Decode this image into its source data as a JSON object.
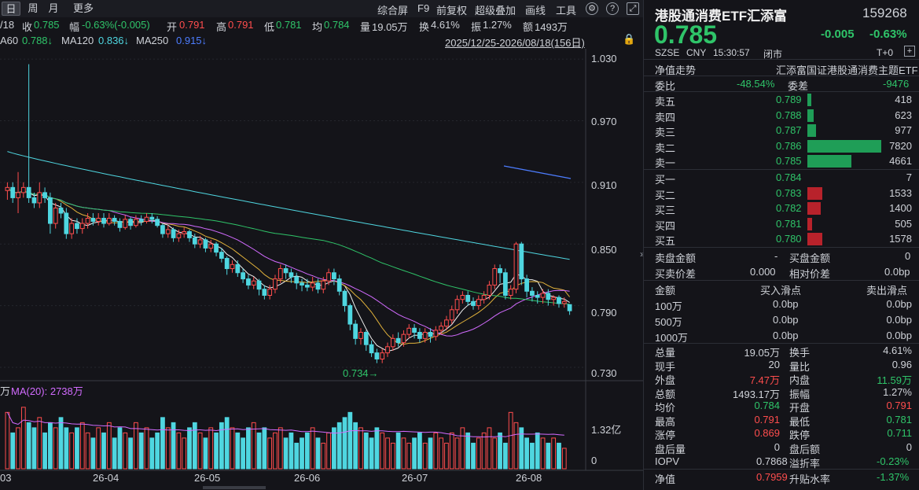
{
  "toolbar": {
    "periods": [
      "日",
      "周",
      "月",
      "更多"
    ],
    "tools": [
      "综合屏",
      "F9",
      "前复权",
      "超级叠加",
      "画线",
      "工具"
    ],
    "icon_names": [
      "gear-icon",
      "help-icon",
      "expand-icon"
    ]
  },
  "infobar": {
    "date": "/18",
    "close_label": "收",
    "close": "0.785",
    "chg_label": "幅",
    "chg": "-0.63%(-0.005)",
    "open_label": "开",
    "open": "0.791",
    "high_label": "高",
    "high": "0.791",
    "low_label": "低",
    "low": "0.781",
    "avg_label": "均",
    "avg": "0.784",
    "vol_label": "量",
    "vol": "19.05万",
    "turn_label": "换",
    "turn": "4.61%",
    "amp_label": "振",
    "amp": "1.27%",
    "amt_label": "额",
    "amt": "1493万"
  },
  "ma_bar": {
    "ma60": "A60",
    "ma60v": "0.788↓",
    "ma120": "MA120",
    "ma120v": "0.836↓",
    "ma250": "MA250",
    "ma250v": "0.915↓",
    "range": "2025/12/25-2026/08/18(156日)"
  },
  "price_axis": [
    "1.030",
    "0.970",
    "0.910",
    "0.850",
    "0.790",
    "0.730"
  ],
  "low_annot": "0.734→",
  "vol_bar": {
    "unit": "万",
    "ma20": "MA(20): 2738万"
  },
  "vol_axis": [
    "1.32亿",
    "0"
  ],
  "x_axis": [
    "03",
    "26-04",
    "26-05",
    "26-06",
    "26-07",
    "26-08"
  ],
  "chart_data": {
    "type": "candlestick",
    "ylim": [
      0.72,
      1.04
    ],
    "candles": [
      [
        0.902,
        0.905,
        0.893,
        0.91
      ],
      [
        0.905,
        0.895,
        0.89,
        0.91
      ],
      [
        0.895,
        0.9,
        0.88,
        0.92
      ],
      [
        0.9,
        0.905,
        0.895,
        0.91
      ],
      [
        0.905,
        0.895,
        0.89,
        1.025
      ],
      [
        0.895,
        0.89,
        0.885,
        0.9
      ],
      [
        0.89,
        0.9,
        0.885,
        0.91
      ],
      [
        0.9,
        0.895,
        0.89,
        0.905
      ],
      [
        0.895,
        0.87,
        0.86,
        0.9
      ],
      [
        0.87,
        0.885,
        0.865,
        0.89
      ],
      [
        0.885,
        0.88,
        0.875,
        0.89
      ],
      [
        0.88,
        0.86,
        0.855,
        0.885
      ],
      [
        0.86,
        0.87,
        0.855,
        0.875
      ],
      [
        0.87,
        0.865,
        0.86,
        0.875
      ],
      [
        0.865,
        0.87,
        0.86,
        0.875
      ],
      [
        0.87,
        0.875,
        0.865,
        0.88
      ],
      [
        0.875,
        0.872,
        0.868,
        0.88
      ],
      [
        0.872,
        0.875,
        0.868,
        0.88
      ],
      [
        0.875,
        0.87,
        0.866,
        0.88
      ],
      [
        0.87,
        0.875,
        0.868,
        0.88
      ],
      [
        0.875,
        0.872,
        0.868,
        0.878
      ],
      [
        0.872,
        0.866,
        0.862,
        0.875
      ],
      [
        0.866,
        0.874,
        0.864,
        0.878
      ],
      [
        0.874,
        0.868,
        0.864,
        0.876
      ],
      [
        0.868,
        0.874,
        0.866,
        0.878
      ],
      [
        0.874,
        0.872,
        0.868,
        0.878
      ],
      [
        0.872,
        0.876,
        0.87,
        0.88
      ],
      [
        0.876,
        0.874,
        0.87,
        0.88
      ],
      [
        0.874,
        0.868,
        0.866,
        0.877
      ],
      [
        0.868,
        0.86,
        0.856,
        0.87
      ],
      [
        0.86,
        0.864,
        0.856,
        0.868
      ],
      [
        0.864,
        0.856,
        0.852,
        0.866
      ],
      [
        0.856,
        0.86,
        0.852,
        0.864
      ],
      [
        0.86,
        0.862,
        0.856,
        0.866
      ],
      [
        0.862,
        0.856,
        0.852,
        0.864
      ],
      [
        0.856,
        0.85,
        0.846,
        0.86
      ],
      [
        0.85,
        0.854,
        0.846,
        0.858
      ],
      [
        0.854,
        0.846,
        0.842,
        0.856
      ],
      [
        0.846,
        0.85,
        0.842,
        0.854
      ],
      [
        0.85,
        0.842,
        0.838,
        0.852
      ],
      [
        0.842,
        0.836,
        0.832,
        0.846
      ],
      [
        0.836,
        0.826,
        0.82,
        0.838
      ],
      [
        0.826,
        0.83,
        0.822,
        0.834
      ],
      [
        0.83,
        0.822,
        0.818,
        0.834
      ],
      [
        0.822,
        0.816,
        0.812,
        0.826
      ],
      [
        0.816,
        0.81,
        0.806,
        0.82
      ],
      [
        0.81,
        0.814,
        0.806,
        0.818
      ],
      [
        0.814,
        0.806,
        0.8,
        0.816
      ],
      [
        0.806,
        0.8,
        0.796,
        0.81
      ],
      [
        0.8,
        0.806,
        0.796,
        0.81
      ],
      [
        0.806,
        0.816,
        0.802,
        0.82
      ],
      [
        0.816,
        0.826,
        0.812,
        0.83
      ],
      [
        0.826,
        0.822,
        0.816,
        0.83
      ],
      [
        0.822,
        0.818,
        0.812,
        0.826
      ],
      [
        0.818,
        0.812,
        0.806,
        0.822
      ],
      [
        0.812,
        0.81,
        0.804,
        0.816
      ],
      [
        0.81,
        0.808,
        0.804,
        0.816
      ],
      [
        0.808,
        0.812,
        0.804,
        0.818
      ],
      [
        0.812,
        0.806,
        0.802,
        0.816
      ],
      [
        0.806,
        0.814,
        0.802,
        0.818
      ],
      [
        0.814,
        0.822,
        0.81,
        0.826
      ],
      [
        0.822,
        0.816,
        0.81,
        0.826
      ],
      [
        0.816,
        0.804,
        0.8,
        0.82
      ],
      [
        0.804,
        0.79,
        0.784,
        0.806
      ],
      [
        0.79,
        0.772,
        0.766,
        0.792
      ],
      [
        0.772,
        0.758,
        0.752,
        0.776
      ],
      [
        0.758,
        0.764,
        0.752,
        0.768
      ],
      [
        0.764,
        0.752,
        0.746,
        0.766
      ],
      [
        0.752,
        0.744,
        0.74,
        0.756
      ],
      [
        0.744,
        0.738,
        0.734,
        0.748
      ],
      [
        0.738,
        0.744,
        0.734,
        0.748
      ],
      [
        0.744,
        0.75,
        0.74,
        0.754
      ],
      [
        0.75,
        0.758,
        0.746,
        0.762
      ],
      [
        0.758,
        0.754,
        0.75,
        0.764
      ],
      [
        0.754,
        0.762,
        0.75,
        0.766
      ],
      [
        0.762,
        0.768,
        0.758,
        0.772
      ],
      [
        0.768,
        0.764,
        0.758,
        0.772
      ],
      [
        0.764,
        0.758,
        0.754,
        0.768
      ],
      [
        0.758,
        0.764,
        0.754,
        0.768
      ],
      [
        0.764,
        0.76,
        0.754,
        0.768
      ],
      [
        0.76,
        0.766,
        0.756,
        0.77
      ],
      [
        0.766,
        0.77,
        0.762,
        0.774
      ],
      [
        0.77,
        0.776,
        0.766,
        0.78
      ],
      [
        0.776,
        0.786,
        0.772,
        0.79
      ],
      [
        0.786,
        0.796,
        0.782,
        0.8
      ],
      [
        0.796,
        0.8,
        0.792,
        0.804
      ],
      [
        0.8,
        0.794,
        0.79,
        0.804
      ],
      [
        0.794,
        0.79,
        0.786,
        0.798
      ],
      [
        0.79,
        0.796,
        0.786,
        0.8
      ],
      [
        0.796,
        0.8,
        0.792,
        0.804
      ],
      [
        0.8,
        0.81,
        0.796,
        0.814
      ],
      [
        0.81,
        0.826,
        0.806,
        0.83
      ],
      [
        0.826,
        0.822,
        0.812,
        0.83
      ],
      [
        0.822,
        0.8,
        0.796,
        0.826
      ],
      [
        0.8,
        0.806,
        0.796,
        0.81
      ],
      [
        0.806,
        0.85,
        0.802,
        0.852
      ],
      [
        0.85,
        0.816,
        0.81,
        0.852
      ],
      [
        0.816,
        0.804,
        0.798,
        0.82
      ],
      [
        0.804,
        0.8,
        0.794,
        0.808
      ],
      [
        0.8,
        0.798,
        0.792,
        0.804
      ],
      [
        0.798,
        0.802,
        0.792,
        0.806
      ],
      [
        0.802,
        0.796,
        0.79,
        0.806
      ],
      [
        0.796,
        0.798,
        0.79,
        0.8
      ],
      [
        0.798,
        0.792,
        0.788,
        0.8
      ],
      [
        0.792,
        0.794,
        0.788,
        0.798
      ],
      [
        0.791,
        0.785,
        0.781,
        0.791
      ]
    ],
    "volumes": [
      1.1,
      0.7,
      0.8,
      1.2,
      0.9,
      0.8,
      1.0,
      0.7,
      0.9,
      0.8,
      1.0,
      0.8,
      0.7,
      0.8,
      0.9,
      0.7,
      0.6,
      0.8,
      0.7,
      0.9,
      0.6,
      0.8,
      0.7,
      0.6,
      0.9,
      0.7,
      0.8,
      0.6,
      0.7,
      1.0,
      0.8,
      0.9,
      0.7,
      0.6,
      0.8,
      0.9,
      0.7,
      0.6,
      0.8,
      0.7,
      0.9,
      1.0,
      0.8,
      0.7,
      0.6,
      0.8,
      0.9,
      0.7,
      0.8,
      0.6,
      0.7,
      0.8,
      0.6,
      0.7,
      0.5,
      0.6,
      0.7,
      0.8,
      0.6,
      0.5,
      0.7,
      0.8,
      0.9,
      1.0,
      1.1,
      0.9,
      0.8,
      0.7,
      0.6,
      0.8,
      0.7,
      0.6,
      0.5,
      0.7,
      0.6,
      0.5,
      0.6,
      0.7,
      0.5,
      0.6,
      0.7,
      0.6,
      0.5,
      0.7,
      0.6,
      0.8,
      0.7,
      0.5,
      0.6,
      0.7,
      0.8,
      0.6,
      0.7,
      0.5,
      1.1,
      0.9,
      0.8,
      0.6,
      0.5,
      0.7,
      0.6,
      0.5,
      0.6,
      0.5,
      0.4
    ]
  },
  "quote": {
    "name": "港股通消费ETF汇添富",
    "code": "159268",
    "price": "0.785",
    "change": "-0.005",
    "pct": "-0.63%",
    "exchange": "SZSE",
    "currency": "CNY",
    "time": "15:30:57",
    "status": "闭市",
    "t0": "T+0",
    "nav_trend": "净值走势",
    "index_name": "汇添富国证港股通消费主题ETF"
  },
  "wb": {
    "label": "委比",
    "value": "-48.54%",
    "diff_label": "委差",
    "diff": "-9476"
  },
  "asks": [
    {
      "label": "卖五",
      "price": "0.789",
      "vol": "418"
    },
    {
      "label": "卖四",
      "price": "0.788",
      "vol": "623"
    },
    {
      "label": "卖三",
      "price": "0.787",
      "vol": "977"
    },
    {
      "label": "卖二",
      "price": "0.786",
      "vol": "7820"
    },
    {
      "label": "卖一",
      "price": "0.785",
      "vol": "4661"
    }
  ],
  "bids": [
    {
      "label": "买一",
      "price": "0.784",
      "vol": "7"
    },
    {
      "label": "买二",
      "price": "0.783",
      "vol": "1533"
    },
    {
      "label": "买三",
      "price": "0.782",
      "vol": "1400"
    },
    {
      "label": "买四",
      "price": "0.781",
      "vol": "505"
    },
    {
      "label": "买五",
      "price": "0.780",
      "vol": "1578"
    }
  ],
  "ask_bar_fracs": [
    0.05,
    0.08,
    0.12,
    1.0,
    0.6
  ],
  "bid_bar_fracs": [
    0.0,
    0.2,
    0.18,
    0.065,
    0.2
  ],
  "disc": {
    "sell_amt_l": "卖盘金额",
    "sell_amt": "-",
    "buy_amt_l": "买盘金额",
    "buy_amt": "0",
    "bs_l": "买卖价差",
    "bs": "0.000",
    "rel_l": "相对价差",
    "rel": "0.0bp"
  },
  "slip_head": {
    "c1": "金额",
    "c2": "买入滑点",
    "c3": "卖出滑点"
  },
  "slip": [
    {
      "amt": "100万",
      "buy": "0.0bp",
      "sell": "0.0bp"
    },
    {
      "amt": "500万",
      "buy": "0.0bp",
      "sell": "0.0bp"
    },
    {
      "amt": "1000万",
      "buy": "0.0bp",
      "sell": "0.0bp"
    }
  ],
  "stats": [
    {
      "l1": "总量",
      "v1": "19.05万",
      "l2": "换手",
      "v2": "4.61%"
    },
    {
      "l1": "现手",
      "v1": "20",
      "l2": "量比",
      "v2": "0.96"
    },
    {
      "l1": "外盘",
      "v1": "7.47万",
      "l2": "内盘",
      "v2": "11.59万"
    },
    {
      "l1": "总额",
      "v1": "1493.17万",
      "l2": "振幅",
      "v2": "1.27%"
    },
    {
      "l1": "均价",
      "v1": "0.784",
      "l2": "开盘",
      "v2": "0.791"
    },
    {
      "l1": "最高",
      "v1": "0.791",
      "l2": "最低",
      "v2": "0.781"
    },
    {
      "l1": "涨停",
      "v1": "0.869",
      "l2": "跌停",
      "v2": "0.711"
    },
    {
      "l1": "盘后量",
      "v1": "0",
      "l2": "盘后额",
      "v2": "0"
    }
  ],
  "iopv": {
    "l1": "IOPV",
    "v1": "0.7868",
    "l2": "溢折率",
    "v2": "-0.23%"
  },
  "nav": {
    "l1": "净值",
    "v1": "0.7959",
    "l2": "升贴水率",
    "v2": "-1.37%"
  }
}
